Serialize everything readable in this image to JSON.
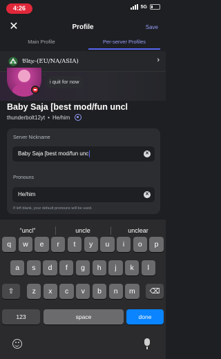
{
  "status_bar": {
    "time": "4:26",
    "network": "5G"
  },
  "header": {
    "title": "Profile",
    "save_label": "Save",
    "close_glyph": "✕"
  },
  "tabs": [
    {
      "label": "Main Profile",
      "active": false
    },
    {
      "label": "Per-server Profiles",
      "active": true
    }
  ],
  "server": {
    "name": "𝔅𝔩𝔞𝔷𝔢-(EU/NA/ASIA)",
    "chevron": "›"
  },
  "profile": {
    "status_text": "i quit for now",
    "display_name": "Baby Saja [best mod/fun uncl",
    "username": "thunderbolt12yt",
    "pronouns_short": "He/him"
  },
  "form": {
    "nickname_label": "Server Nickname",
    "nickname_value": "Baby Saja [best mod/fun unc",
    "pronouns_label": "Pronouns",
    "pronouns_value": "He/him",
    "hint": "If left blank, your default pronouns will be used.",
    "clear_glyph": "✕"
  },
  "keyboard": {
    "suggestions": [
      "“uncl”",
      "uncle",
      "unclear"
    ],
    "row1": [
      "q",
      "w",
      "e",
      "r",
      "t",
      "y",
      "u",
      "i",
      "o",
      "p"
    ],
    "row2": [
      "a",
      "s",
      "d",
      "f",
      "g",
      "h",
      "j",
      "k",
      "l"
    ],
    "row3": [
      "z",
      "x",
      "c",
      "v",
      "b",
      "n",
      "m"
    ],
    "shift_glyph": "⇧",
    "delete_glyph": "⌫",
    "num_label": "123",
    "space_label": "space",
    "done_label": "done"
  },
  "colors": {
    "accent": "#5865f2",
    "accent_text": "#949cf7",
    "done_key": "#0a84ff",
    "time_pill": "#e0283a"
  }
}
